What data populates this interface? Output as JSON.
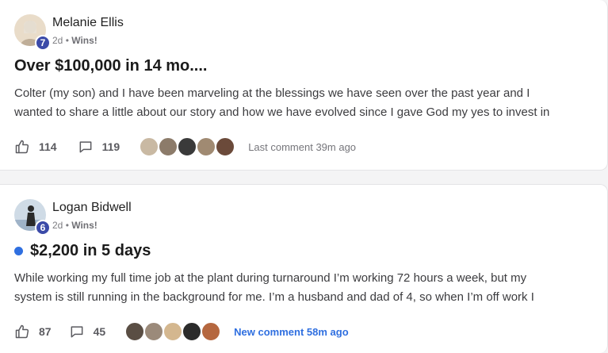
{
  "posts": [
    {
      "author": "Melanie Ellis",
      "level": "7",
      "age": "2d",
      "separator": "•",
      "category": "Wins!",
      "title": "Over $100,000 in 14 mo....",
      "unread": false,
      "body_lines": [
        "Colter (my son) and I have been marveling at the blessings we have seen over the past year and I",
        "wanted to share a little about our story and how we have evolved since I gave God my yes to invest in"
      ],
      "likes": "114",
      "comments": "119",
      "comment_status": "Last comment 39m ago",
      "avatar_colors": [
        "#c9b9a3",
        "#8c7b6a",
        "#3a3a3a",
        "#a08a72",
        "#6b4a3a"
      ],
      "author_avatar_color": "#d8c6ae"
    },
    {
      "author": "Logan Bidwell",
      "level": "6",
      "age": "2d",
      "separator": "•",
      "category": "Wins!",
      "title": "$2,200 in 5 days",
      "unread": true,
      "body_lines": [
        "While working my full time job at the plant during turnaround I’m working 72 hours a week, but my",
        "system is still running in the background for me. I’m a husband and dad of 4, so when I’m off work I"
      ],
      "likes": "87",
      "comments": "45",
      "comment_status": "New comment 58m ago",
      "avatar_colors": [
        "#5a4e44",
        "#9b8a7a",
        "#d4b78f",
        "#2b2b2b",
        "#b5673f"
      ],
      "author_avatar_color": "#9fb3c8"
    }
  ],
  "colors": {
    "level_badge": "#3b4aa8",
    "unread_dot": "#2f6fe0",
    "new_comment": "#2f6fe0"
  },
  "icons": {
    "like": "thumbs-up-icon",
    "comment": "comment-bubble-icon"
  }
}
